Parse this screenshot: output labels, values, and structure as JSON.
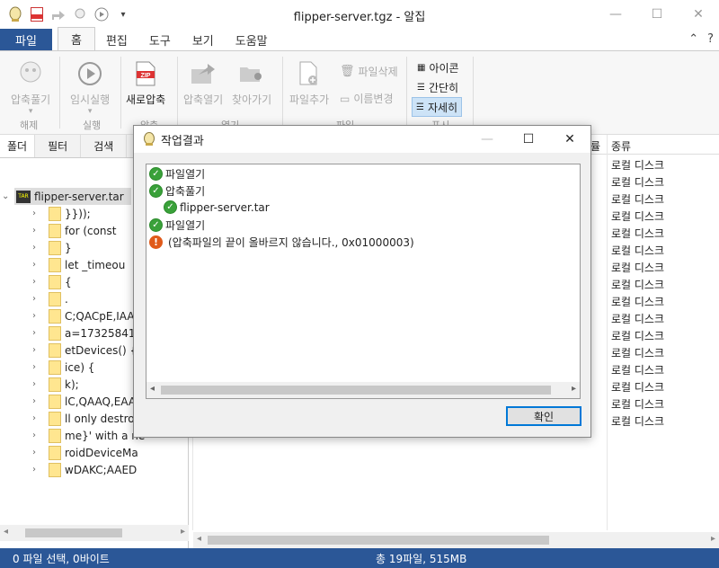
{
  "window": {
    "title": "flipper-server.tgz - 알집",
    "controls": [
      "minimize",
      "maximize",
      "close"
    ]
  },
  "ribbon_tabs": {
    "file": "파일",
    "tabs": [
      "홈",
      "편집",
      "도구",
      "보기",
      "도움말"
    ],
    "active": "홈"
  },
  "ribbon": {
    "extract": "압축풀기",
    "temp_run": "임시실행",
    "new_zip": "새로압축",
    "open_zip": "압축열기",
    "locate": "찾아가기",
    "add_file": "파일추가",
    "delete_file": "파일삭제",
    "rename": "이름변경",
    "view_icon": "아이콘",
    "view_simple": "간단히",
    "view_detail": "자세히",
    "groups": {
      "extract": "해제",
      "run": "실행",
      "zip": "압축",
      "open": "열기",
      "file": "파일",
      "view": "표시"
    }
  },
  "left_panel": {
    "tabs": [
      "폴더",
      "필터",
      "검색"
    ],
    "root": "flipper-server.tar",
    "tree_items": [
      "}}));",
      "for (const",
      "}",
      "let _timeou",
      "{",
      ".",
      "C;QACpE,IAAI",
      "a=173258419",
      "etDevices() {",
      "ice) {",
      "k);",
      "lC,QAAQ,EAA",
      "ll only destroy",
      "me}' with a ne",
      "roidDeviceMa",
      "wDAKC;AAED"
    ]
  },
  "list": {
    "column_header": "종류",
    "column_header_partial": "률",
    "rows": [
      "로컬 디스크",
      "로컬 디스크",
      "로컬 디스크",
      "로컬 디스크",
      "로컬 디스크",
      "로컬 디스크",
      "로컬 디스크",
      "로컬 디스크",
      "로컬 디스크",
      "로컬 디스크",
      "로컬 디스크",
      "로컬 디스크",
      "로컬 디스크",
      "로컬 디스크",
      "로컬 디스크",
      "로컬 디스크"
    ]
  },
  "dialog": {
    "title": "작업결과",
    "log": [
      {
        "status": "ok",
        "text": "파일열기",
        "indent": 0
      },
      {
        "status": "ok",
        "text": "압축풀기",
        "indent": 0
      },
      {
        "status": "ok",
        "text": "flipper-server.tar",
        "indent": 1
      },
      {
        "status": "ok",
        "text": "파일열기",
        "indent": 0
      },
      {
        "status": "error",
        "text": "(압축파일의 끝이 올바르지 않습니다., 0x01000003)",
        "indent": 0
      }
    ],
    "confirm": "확인"
  },
  "statusbar": {
    "selection": "0 파일 선택,  0바이트",
    "total": "총 19파일,  515MB"
  },
  "colors": {
    "accent": "#2b5797",
    "ok": "#3aa13a",
    "error": "#e05a1a",
    "dialog_button_border": "#0078d7"
  }
}
